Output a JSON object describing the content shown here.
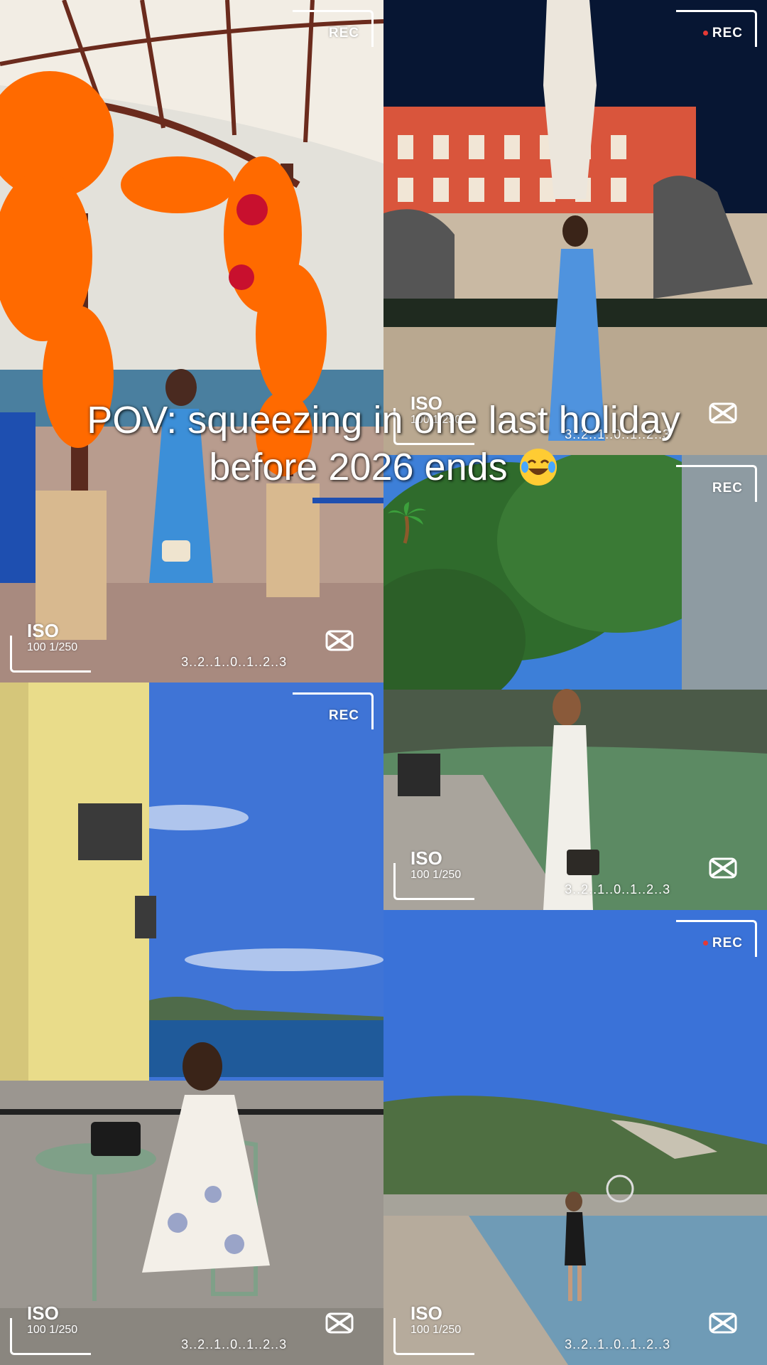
{
  "caption": {
    "text": "POV: squeezing in one last holiday before 2026 ends",
    "emoji": "face-with-tears-of-joy",
    "extra_icon": "palm-tree"
  },
  "overlay": {
    "rec_label": "REC",
    "iso_label": "ISO",
    "iso_value": "100 1/250",
    "exposure_scale": "3..2..1..0..1..2..3",
    "logo_icon": "capcut-icon"
  },
  "panels": [
    {
      "id": "flower-gazebo",
      "rec_dot": false
    },
    {
      "id": "statue-fountain",
      "rec_dot": true
    },
    {
      "id": "garden-fountain",
      "rec_dot": false
    },
    {
      "id": "terrace-seaview",
      "rec_dot": false
    },
    {
      "id": "beach",
      "rec_dot": true
    }
  ],
  "colors": {
    "overlay": "#ffffff",
    "rec_dot": "#e53935",
    "sky": "#3b6fd6",
    "flowers": "#ff6a00"
  }
}
